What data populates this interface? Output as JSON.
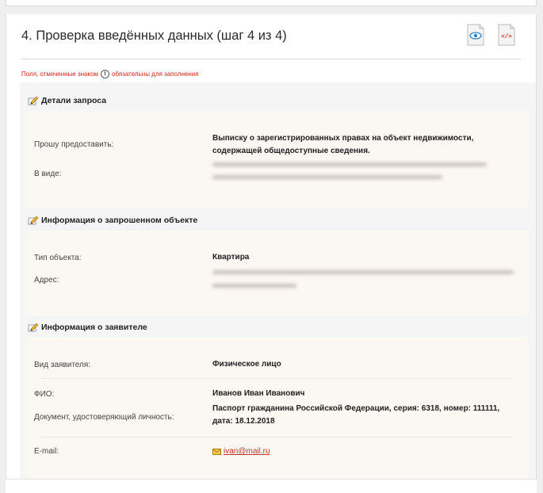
{
  "header": {
    "title": "4. Проверка введённых данных (шаг 4 из 4)",
    "preview_icon": "eye-document-icon",
    "code_icon": "code-document-icon"
  },
  "required_note": {
    "before": "Поля, отмеченные знаком",
    "mark": "!",
    "after": "обязательны для заполнения"
  },
  "sections": {
    "request": {
      "title": "Детали запроса",
      "fields": {
        "provide_label": "Прошу предоставить:",
        "provide_value": "Выписку о зарегистрированных правах на объект недвижимости, содержащей общедоступные сведения.",
        "form_label": "В виде:"
      }
    },
    "object": {
      "title": "Информация о запрошенном объекте",
      "fields": {
        "type_label": "Тип объекта:",
        "type_value": "Квартира",
        "address_label": "Адрес:"
      }
    },
    "applicant": {
      "title": "Информация о заявителе",
      "fields": {
        "kind_label": "Вид заявителя:",
        "kind_value": "Физическое лицо",
        "fio_label": "ФИО:",
        "fio_value": "Иванов Иван Иванович",
        "doc_label": "Документ, удостоверяющий личность:",
        "doc_value": "Паспорт гражданина Российской Федерации, серия: 6318, номер: 111111, дата: 18.12.2018",
        "email_label": "E-mail:",
        "email_value": "ivan@mail.ru"
      }
    }
  },
  "colors": {
    "accent_red": "#d0281b",
    "box_bg": "#fbf7f3"
  }
}
